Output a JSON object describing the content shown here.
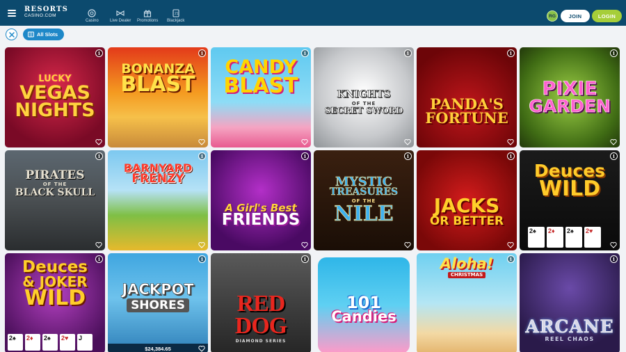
{
  "header": {
    "logo_line1": "RESORTS",
    "logo_line2": "CASINO.COM",
    "nav": [
      {
        "label": "Casino",
        "icon": "casino-chip-icon"
      },
      {
        "label": "Live Dealer",
        "icon": "live-dealer-icon"
      },
      {
        "label": "Promotions",
        "icon": "gift-icon"
      },
      {
        "label": "Blackjack",
        "icon": "playing-card-icon"
      }
    ],
    "rg_badge": "RG",
    "join_label": "JOIN",
    "login_label": "LOGIN"
  },
  "filter": {
    "active_filter_label": "All Slots"
  },
  "colors": {
    "header_bg": "#0c4a6e",
    "accent_blue": "#1e88c8",
    "login_green": "#a6ce39"
  },
  "games": [
    {
      "title_lines": [
        "LUCKY",
        "VEGAS",
        "NIGHTS"
      ]
    },
    {
      "title_lines": [
        "BONANZA",
        "BLAST"
      ]
    },
    {
      "title_lines": [
        "CANDY",
        "BLAST"
      ]
    },
    {
      "title_lines": [
        "KNIGHTS",
        "OF THE",
        "SECRET SWORD"
      ]
    },
    {
      "title_lines": [
        "PANDA'S",
        "FORTUNE"
      ]
    },
    {
      "title_lines": [
        "PIXIE",
        "GARDEN"
      ]
    },
    {
      "title_lines": [
        "PIRATES",
        "OF THE",
        "BLACK SKULL"
      ]
    },
    {
      "title_lines": [
        "BARNYARD",
        "FRENZY"
      ]
    },
    {
      "title_lines": [
        "A Girl's Best",
        "FRIENDS"
      ]
    },
    {
      "title_lines": [
        "MYSTIC",
        "TREASURES",
        "OF THE",
        "NILE"
      ]
    },
    {
      "title_lines": [
        "JACKS",
        "OR BETTER"
      ]
    },
    {
      "title_lines": [
        "Deuces",
        "WILD"
      ]
    },
    {
      "title_lines": [
        "Deuces",
        "& JOKER",
        "WILD"
      ]
    },
    {
      "title_lines": [
        "JACKPOT",
        "SHORES"
      ],
      "jackpot": "$24,384.65"
    },
    {
      "title_lines": [
        "RED DOG",
        "DIAMOND SERIES"
      ]
    },
    {
      "title_lines": [
        "101",
        "Candies"
      ]
    },
    {
      "title_lines": [
        "Aloha!",
        "CHRISTMAS"
      ]
    },
    {
      "title_lines": [
        "ARCANE",
        "REEL CHAOS"
      ]
    }
  ]
}
